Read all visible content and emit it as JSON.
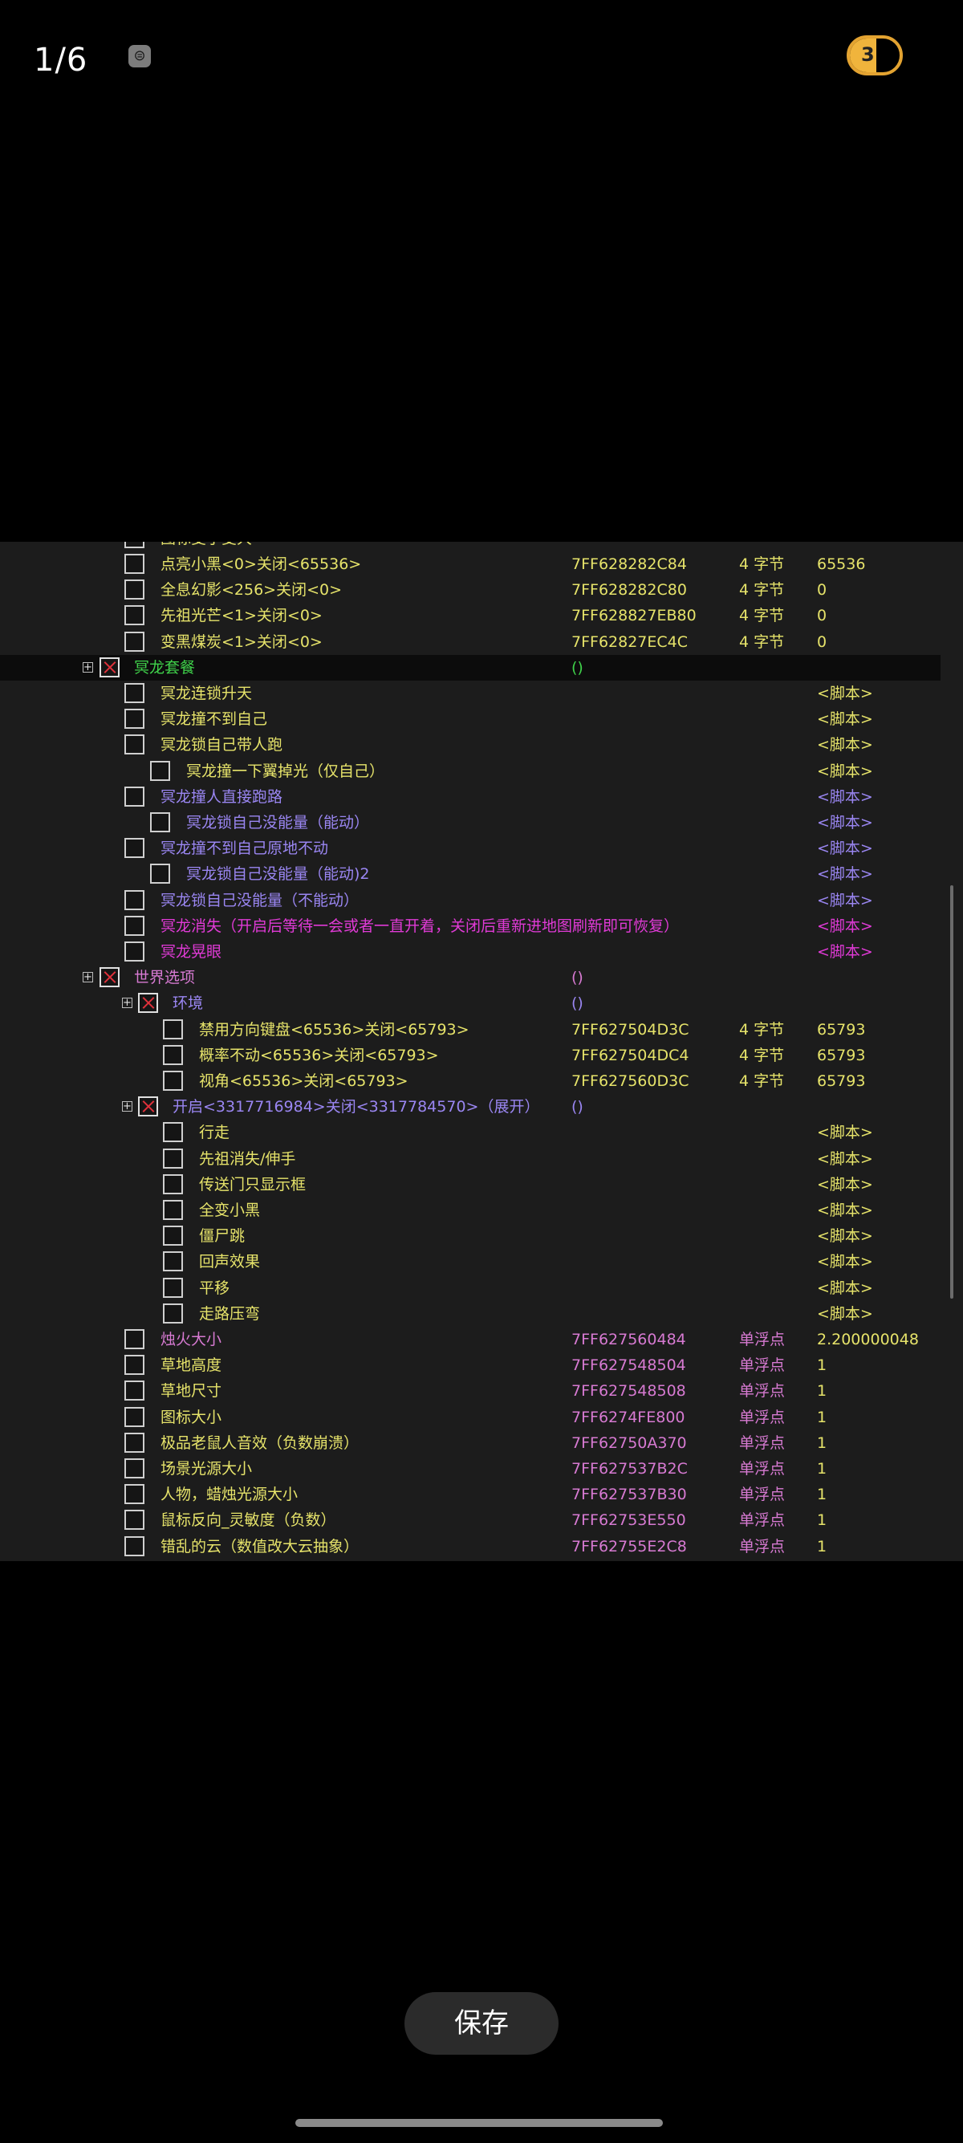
{
  "topbar": {
    "counter": "1/6",
    "badge_glyph": "⊜",
    "toggle_glyph": "3"
  },
  "colors": {
    "yellow": "#e6e36a",
    "green": "#3fd14a",
    "purple": "#9a86f2",
    "magenta": "#e03ad6",
    "pink": "#d77ad2"
  },
  "partial_top_text": "图标变小变大",
  "rows": [
    {
      "desc": "点亮小黑<0>关闭<65536>",
      "addr": "7FF628282C84",
      "type": "4 字节",
      "value": "65536"
    },
    {
      "desc": "全息幻影<256>关闭<0>",
      "addr": "7FF628282C80",
      "type": "4 字节",
      "value": "0"
    },
    {
      "desc": "先祖光芒<1>关闭<0>",
      "addr": "7FF628827EB80",
      "type": "4 字节",
      "value": "0"
    },
    {
      "desc": "变黑煤炭<1>关闭<0>",
      "addr": "7FF62827EC4C",
      "type": "4 字节",
      "value": "0"
    },
    {
      "desc": "冥龙套餐",
      "addr": "()",
      "type": "",
      "value": ""
    },
    {
      "desc": "冥龙连锁升天",
      "addr": "",
      "type": "",
      "value": "<脚本>"
    },
    {
      "desc": "冥龙撞不到自己",
      "addr": "",
      "type": "",
      "value": "<脚本>"
    },
    {
      "desc": "冥龙锁自己带人跑",
      "addr": "",
      "type": "",
      "value": "<脚本>"
    },
    {
      "desc": "冥龙撞一下翼掉光（仅自己）",
      "addr": "",
      "type": "",
      "value": "<脚本>"
    },
    {
      "desc": "冥龙撞人直接跑路",
      "addr": "",
      "type": "",
      "value": "<脚本>"
    },
    {
      "desc": "冥龙锁自己没能量（能动）",
      "addr": "",
      "type": "",
      "value": "<脚本>"
    },
    {
      "desc": "冥龙撞不到自己原地不动",
      "addr": "",
      "type": "",
      "value": "<脚本>"
    },
    {
      "desc": "冥龙锁自己没能量（能动)2",
      "addr": "",
      "type": "",
      "value": "<脚本>"
    },
    {
      "desc": "冥龙锁自己没能量（不能动）",
      "addr": "",
      "type": "",
      "value": "<脚本>"
    },
    {
      "desc": "冥龙消失（开启后等待一会或者一直开着，关闭后重新进地图刷新即可恢复）",
      "addr": "",
      "type": "",
      "value": "<脚本>"
    },
    {
      "desc": "冥龙晃眼",
      "addr": "",
      "type": "",
      "value": "<脚本>"
    },
    {
      "desc": "世界选项",
      "addr": "()",
      "type": "",
      "value": ""
    },
    {
      "desc": "环境",
      "addr": "()",
      "type": "",
      "value": ""
    },
    {
      "desc": "禁用方向键盘<65536>关闭<65793>",
      "addr": "7FF627504D3C",
      "type": "4 字节",
      "value": "65793"
    },
    {
      "desc": "概率不动<65536>关闭<65793>",
      "addr": "7FF627504DC4",
      "type": "4 字节",
      "value": "65793"
    },
    {
      "desc": "视角<65536>关闭<65793>",
      "addr": "7FF627560D3C",
      "type": "4 字节",
      "value": "65793"
    },
    {
      "desc": "开启<3317716984>关闭<3317784570>（展开）",
      "addr": "()",
      "type": "",
      "value": ""
    },
    {
      "desc": "行走",
      "addr": "",
      "type": "",
      "value": "<脚本>"
    },
    {
      "desc": "先祖消失/伸手",
      "addr": "",
      "type": "",
      "value": "<脚本>"
    },
    {
      "desc": "传送门只显示框",
      "addr": "",
      "type": "",
      "value": "<脚本>"
    },
    {
      "desc": "全变小黑",
      "addr": "",
      "type": "",
      "value": "<脚本>"
    },
    {
      "desc": "僵尸跳",
      "addr": "",
      "type": "",
      "value": "<脚本>"
    },
    {
      "desc": "回声效果",
      "addr": "",
      "type": "",
      "value": "<脚本>"
    },
    {
      "desc": "平移",
      "addr": "",
      "type": "",
      "value": "<脚本>"
    },
    {
      "desc": "走路压弯",
      "addr": "",
      "type": "",
      "value": "<脚本>"
    },
    {
      "desc": "烛火大小",
      "addr": "7FF627560484",
      "type": "单浮点",
      "value": "2.200000048"
    },
    {
      "desc": "草地高度",
      "addr": "7FF627548504",
      "type": "单浮点",
      "value": "1"
    },
    {
      "desc": "草地尺寸",
      "addr": "7FF627548508",
      "type": "单浮点",
      "value": "1"
    },
    {
      "desc": "图标大小",
      "addr": "7FF6274FE800",
      "type": "单浮点",
      "value": "1"
    },
    {
      "desc": "极品老鼠人音效（负数崩溃）",
      "addr": "7FF62750A370",
      "type": "单浮点",
      "value": "1"
    },
    {
      "desc": "场景光源大小",
      "addr": "7FF627537B2C",
      "type": "单浮点",
      "value": "1"
    },
    {
      "desc": "人物，蜡烛光源大小",
      "addr": "7FF627537B30",
      "type": "单浮点",
      "value": "1"
    },
    {
      "desc": "鼠标反向_灵敏度（负数）",
      "addr": "7FF62753E550",
      "type": "单浮点",
      "value": "1"
    },
    {
      "desc": "错乱的云（数值改大云抽象）",
      "addr": "7FF62755E2C8",
      "type": "单浮点",
      "value": "1"
    }
  ],
  "save_button": "保存"
}
